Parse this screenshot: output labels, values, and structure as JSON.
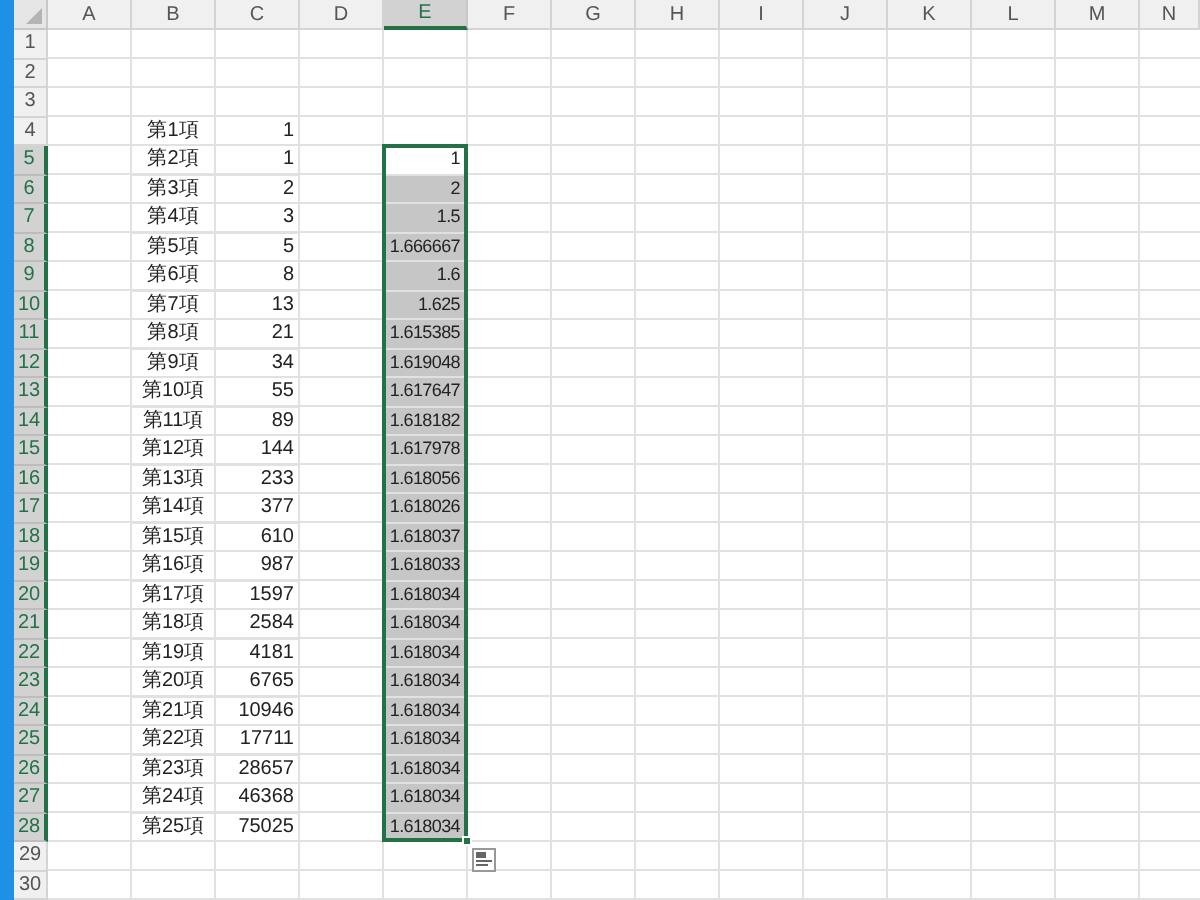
{
  "columns": [
    {
      "label": "A",
      "selected": false
    },
    {
      "label": "B",
      "selected": false
    },
    {
      "label": "C",
      "selected": false
    },
    {
      "label": "D",
      "selected": false
    },
    {
      "label": "E",
      "selected": true
    },
    {
      "label": "F",
      "selected": false
    },
    {
      "label": "G",
      "selected": false
    },
    {
      "label": "H",
      "selected": false
    },
    {
      "label": "I",
      "selected": false
    },
    {
      "label": "J",
      "selected": false
    },
    {
      "label": "K",
      "selected": false
    },
    {
      "label": "L",
      "selected": false
    },
    {
      "label": "M",
      "selected": false
    },
    {
      "label": "N",
      "selected": false
    }
  ],
  "rows": [
    {
      "number": "1",
      "selected": false
    },
    {
      "number": "2",
      "selected": false
    },
    {
      "number": "3",
      "selected": false
    },
    {
      "number": "4",
      "selected": false,
      "b": "第1項",
      "c": "1"
    },
    {
      "number": "5",
      "selected": true,
      "b": "第2項",
      "c": "1",
      "e": "1",
      "active": true
    },
    {
      "number": "6",
      "selected": true,
      "b": "第3項",
      "c": "2",
      "e": "2",
      "active": false
    },
    {
      "number": "7",
      "selected": true,
      "b": "第4項",
      "c": "3",
      "e": "1.5",
      "active": false
    },
    {
      "number": "8",
      "selected": true,
      "b": "第5項",
      "c": "5",
      "e": "1.666667",
      "active": false
    },
    {
      "number": "9",
      "selected": true,
      "b": "第6項",
      "c": "8",
      "e": "1.6",
      "active": false
    },
    {
      "number": "10",
      "selected": true,
      "b": "第7項",
      "c": "13",
      "e": "1.625",
      "active": false
    },
    {
      "number": "11",
      "selected": true,
      "b": "第8項",
      "c": "21",
      "e": "1.615385",
      "active": false
    },
    {
      "number": "12",
      "selected": true,
      "b": "第9項",
      "c": "34",
      "e": "1.619048",
      "active": false
    },
    {
      "number": "13",
      "selected": true,
      "b": "第10項",
      "c": "55",
      "e": "1.617647",
      "active": false
    },
    {
      "number": "14",
      "selected": true,
      "b": "第11項",
      "c": "89",
      "e": "1.618182",
      "active": false
    },
    {
      "number": "15",
      "selected": true,
      "b": "第12項",
      "c": "144",
      "e": "1.617978",
      "active": false
    },
    {
      "number": "16",
      "selected": true,
      "b": "第13項",
      "c": "233",
      "e": "1.618056",
      "active": false
    },
    {
      "number": "17",
      "selected": true,
      "b": "第14項",
      "c": "377",
      "e": "1.618026",
      "active": false
    },
    {
      "number": "18",
      "selected": true,
      "b": "第15項",
      "c": "610",
      "e": "1.618037",
      "active": false
    },
    {
      "number": "19",
      "selected": true,
      "b": "第16項",
      "c": "987",
      "e": "1.618033",
      "active": false
    },
    {
      "number": "20",
      "selected": true,
      "b": "第17項",
      "c": "1597",
      "e": "1.618034",
      "active": false
    },
    {
      "number": "21",
      "selected": true,
      "b": "第18項",
      "c": "2584",
      "e": "1.618034",
      "active": false
    },
    {
      "number": "22",
      "selected": true,
      "b": "第19項",
      "c": "4181",
      "e": "1.618034",
      "active": false
    },
    {
      "number": "23",
      "selected": true,
      "b": "第20項",
      "c": "6765",
      "e": "1.618034",
      "active": false
    },
    {
      "number": "24",
      "selected": true,
      "b": "第21項",
      "c": "10946",
      "e": "1.618034",
      "active": false
    },
    {
      "number": "25",
      "selected": true,
      "b": "第22項",
      "c": "17711",
      "e": "1.618034",
      "active": false
    },
    {
      "number": "26",
      "selected": true,
      "b": "第23項",
      "c": "28657",
      "e": "1.618034",
      "active": false
    },
    {
      "number": "27",
      "selected": true,
      "b": "第24項",
      "c": "46368",
      "e": "1.618034",
      "active": false
    },
    {
      "number": "28",
      "selected": true,
      "b": "第25項",
      "c": "75025",
      "e": "1.618034",
      "active": false
    },
    {
      "number": "29",
      "selected": false
    },
    {
      "number": "30",
      "selected": false
    }
  ]
}
